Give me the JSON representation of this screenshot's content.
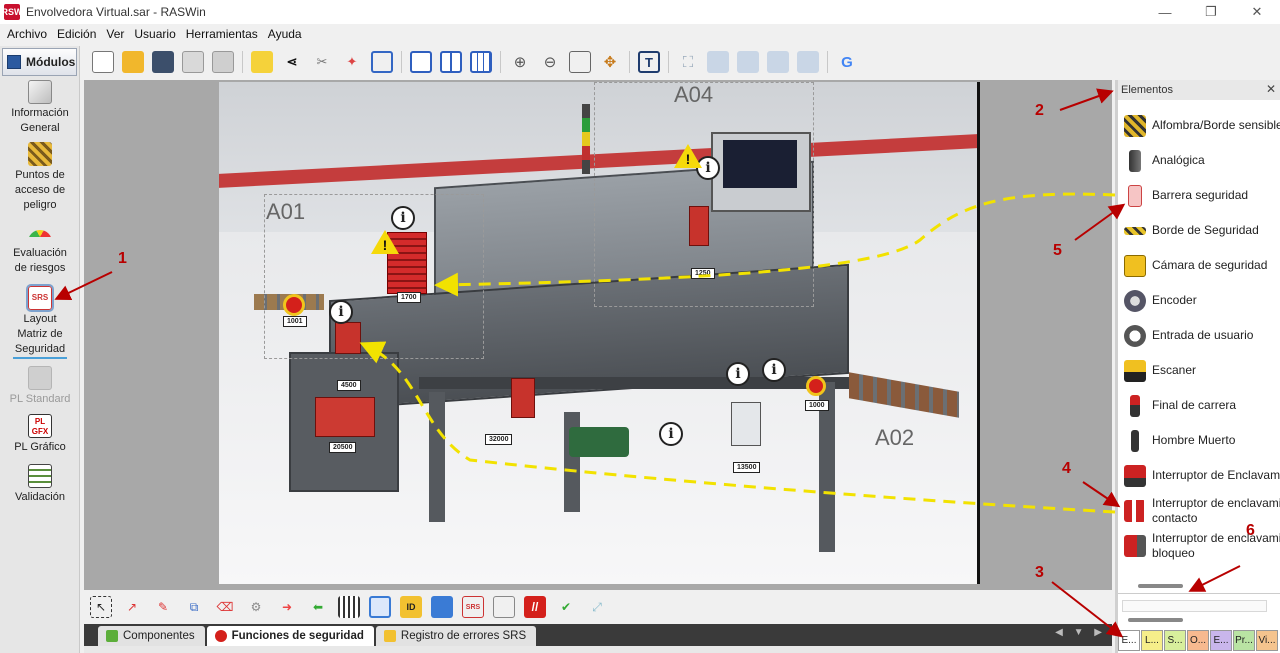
{
  "window": {
    "title": "Envolvedora Virtual.sar - RASWin",
    "app_icon": "RSW",
    "controls": [
      "—",
      "❐",
      "✕"
    ]
  },
  "menu": [
    "Archivo",
    "Edición",
    "Ver",
    "Usuario",
    "Herramientas",
    "Ayuda"
  ],
  "modules": {
    "header": "Módulos",
    "items": [
      {
        "label": "Información General",
        "icon": "document-info-icon",
        "state": "normal"
      },
      {
        "label": "Puntos de acceso de peligro",
        "icon": "hazard-points-icon",
        "state": "normal"
      },
      {
        "label": "Evaluación de riesgos",
        "icon": "risk-gauge-icon",
        "state": "normal"
      },
      {
        "label": "Layout Matriz de Seguridad",
        "icon": "srs-layout-icon",
        "state": "selected"
      },
      {
        "label": "PL Standard",
        "icon": "pl-standard-icon",
        "state": "disabled"
      },
      {
        "label": "PL Gráfico",
        "icon": "pl-graph-icon",
        "state": "normal"
      },
      {
        "label": "Validación",
        "icon": "validation-checklist-icon",
        "state": "normal"
      }
    ]
  },
  "scene": {
    "zones": [
      "A01",
      "A04",
      "A02"
    ],
    "tags": [
      "1700",
      "1250",
      "1001",
      "4500",
      "20500",
      "32000",
      "13500",
      "1000"
    ]
  },
  "bottom_tabs": [
    {
      "label": "Componentes",
      "icon": "puzzle-icon",
      "active": false
    },
    {
      "label": "Funciones de seguridad",
      "icon": "sf-icon",
      "active": true
    },
    {
      "label": "Registro de errores SRS",
      "icon": "warning-icon",
      "active": false
    }
  ],
  "elements_panel": {
    "title": "Elementos",
    "close": "✕",
    "items": [
      {
        "label": "Alfombra/Borde sensible",
        "icon": "safety-mat-icon"
      },
      {
        "label": "Analógica",
        "icon": "analog-sensor-icon"
      },
      {
        "label": "Barrera seguridad",
        "icon": "light-curtain-icon"
      },
      {
        "label": "Borde de Seguridad",
        "icon": "safety-edge-icon"
      },
      {
        "label": "Cámara de seguridad",
        "icon": "safety-camera-icon"
      },
      {
        "label": "Encoder",
        "icon": "encoder-icon"
      },
      {
        "label": "Entrada de usuario",
        "icon": "user-input-icon"
      },
      {
        "label": "Escaner",
        "icon": "scanner-icon"
      },
      {
        "label": "Final de carrera",
        "icon": "limit-switch-icon"
      },
      {
        "label": "Hombre Muerto",
        "icon": "enabling-switch-icon"
      },
      {
        "label": "Interruptor de Enclavami",
        "icon": "interlock-switch-icon"
      },
      {
        "label": "Interruptor de enclavami contacto",
        "icon": "contact-interlock-icon"
      },
      {
        "label": "Interruptor de enclavami bloqueo",
        "icon": "locking-interlock-icon"
      }
    ],
    "palette_tabs": [
      "E...",
      "L...",
      "S...",
      "O...",
      "E...",
      "Pr...",
      "Vi..."
    ],
    "palette_colors": [
      "#ffffff",
      "#f6ee8a",
      "#d8ef9c",
      "#f7b98f",
      "#c9b6ec",
      "#b9e3a3",
      "#f5c48e"
    ]
  },
  "annotations": [
    "1",
    "2",
    "3",
    "4",
    "5",
    "6"
  ],
  "colors": {
    "annotation_red": "#b80000",
    "dash_yellow": "#f2e200",
    "selection_blue": "#4aa0d8"
  }
}
